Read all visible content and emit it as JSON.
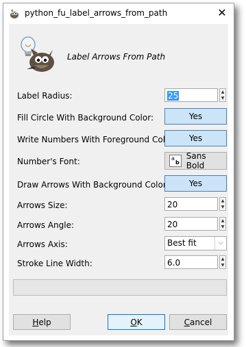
{
  "window": {
    "title": "python_fu_label_arrows_from_path",
    "close_symbol": "✕"
  },
  "header": {
    "title": "Label Arrows From Path",
    "icon": "gimp-wilber-lightbulb-icon"
  },
  "fields": {
    "label_radius": {
      "label": "Label Radius:",
      "value": "25"
    },
    "fill_circle": {
      "label": "Fill Circle With Background Color:",
      "value": "Yes"
    },
    "write_numbers": {
      "label": "Write Numbers With Foreground Color:",
      "value": "Yes"
    },
    "numbers_font": {
      "label": "Number's Font:",
      "value": "Sans Bold"
    },
    "draw_arrows": {
      "label": "Draw Arrows With Background Color:",
      "value": "Yes"
    },
    "arrows_size": {
      "label": "Arrows Size:",
      "value": "20"
    },
    "arrows_angle": {
      "label": "Arrows Angle:",
      "value": "20"
    },
    "arrows_axis": {
      "label": "Arrows Axis:",
      "value": "Best fit"
    },
    "stroke_line_width": {
      "label": "Stroke Line Width:",
      "value": "6.0"
    }
  },
  "buttons": {
    "help": {
      "label": "Help",
      "mnemonic": "H",
      "rest": "elp"
    },
    "ok": {
      "label": "OK",
      "mnemonic": "O",
      "rest": "K"
    },
    "cancel": {
      "label": "Cancel",
      "mnemonic": "C",
      "rest": "ancel"
    }
  },
  "colors": {
    "toggle_bg": "#cce4f7",
    "toggle_border": "#4a7fb5",
    "selection": "#3399ff",
    "dialog_bg": "#f0f0f0"
  }
}
